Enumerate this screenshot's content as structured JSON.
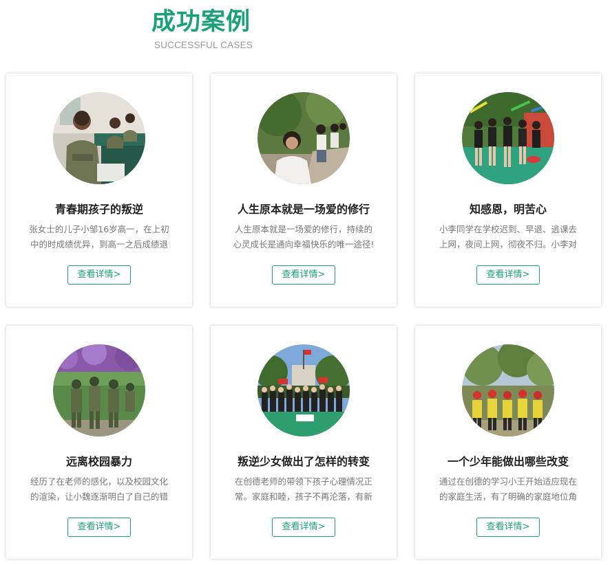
{
  "header": {
    "title": "成功案例",
    "subtitle": "SUCCESSFUL CASES"
  },
  "colors": {
    "accent": "#1aa17a",
    "title_text": "#222222",
    "desc_text": "#777777"
  },
  "cases": [
    {
      "title": "青春期孩子的叛逆",
      "desc": "张女士的儿子小邹16岁高一，在上初中的时成绩优异，到高一之后成绩退",
      "button": "查看详情>",
      "image": "students-in-classroom-photo"
    },
    {
      "title": "人生原本就是一场爱的修行",
      "desc": "人生原本就是一场爱的修行，持续的心灵成长是通向幸福快乐的唯一途径!",
      "button": "查看详情>",
      "image": "girl-sitting-outdoors-photo"
    },
    {
      "title": "知感恩，明苦心",
      "desc": "小李同学在学校迟到、早退、逃课去上网，夜间上网，彻夜不归。小李对网",
      "button": "查看详情>",
      "image": "girls-on-playground-photo"
    },
    {
      "title": "远离校园暴力",
      "desc": "经历了在老师的感化，以及校园文化的渲染，让小魏逐渐明白了自己的错误",
      "button": "查看详情>",
      "image": "students-in-camouflage-photo"
    },
    {
      "title": "叛逆少女做出了怎样的转变",
      "desc": "在创德老师的带领下孩子心理情况正常。家庭和睦，孩子不再沦落，有新的",
      "button": "查看详情>",
      "image": "group-on-field-with-flags-photo"
    },
    {
      "title": "一个少年能做出哪些改变",
      "desc": "通过在创德的学习小王开始适应现在的家庭生活，有了明确的家庭地位角色",
      "button": "查看详情>",
      "image": "group-in-yellow-vests-photo"
    }
  ]
}
